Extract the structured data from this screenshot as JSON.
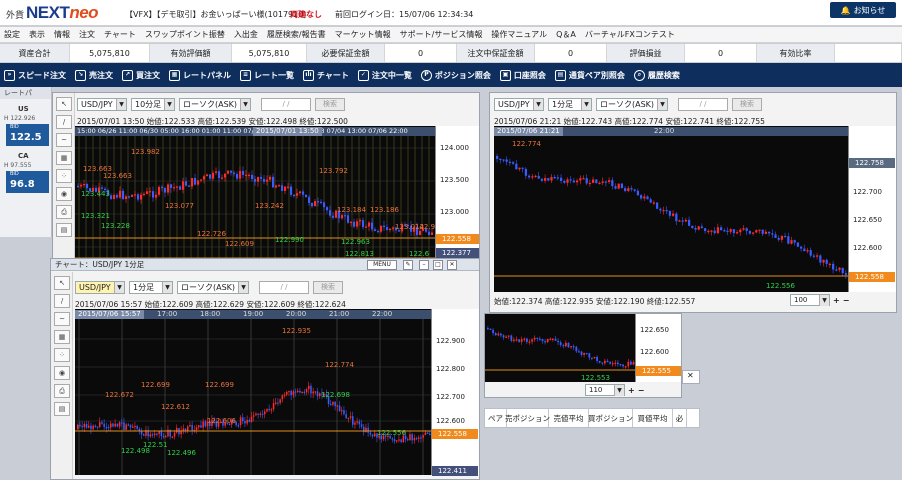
{
  "header": {
    "logo_prefix": "外貨",
    "logo_main": "NEXT",
    "logo_neo": "neo",
    "account": "【VFX】【デモ取引】お金いっぱーい様(1017910)",
    "dup_status": "両建なし",
    "last_login": "前回ログイン日：15/07/06 12:34:34",
    "news_button": "お知らせ"
  },
  "menu": [
    "設定",
    "表示",
    "情報",
    "注文",
    "チャート",
    "スワップポイント振替",
    "入出金",
    "履歴検索/報告書",
    "マーケット情報",
    "サポート/サービス情報",
    "操作マニュアル",
    "Q＆A",
    "バーチャルFXコンテスト"
  ],
  "summary": [
    {
      "label": "資産合計",
      "value": "5,075,810"
    },
    {
      "label": "有効評価額",
      "value": "5,075,810"
    },
    {
      "label": "必要保証金額",
      "value": "0"
    },
    {
      "label": "注文中保証金額",
      "value": "0"
    },
    {
      "label": "評価損益",
      "value": "0"
    },
    {
      "label": "有効比率",
      "value": ""
    }
  ],
  "toolbar": [
    "スピード注文",
    "売注文",
    "買注文",
    "レートパネル",
    "レート一覧",
    "チャート",
    "注文中一覧",
    "ポジション照会",
    "口座照会",
    "通貨ペア別照会",
    "履歴検索"
  ],
  "rate_panel": {
    "head": "レートパ",
    "pairs": [
      {
        "pair": "US",
        "high": "H 122.926",
        "bid": "122.5",
        "bid_label": "BID"
      },
      {
        "pair": "CA",
        "high": "H 97.555",
        "bid": "96.8",
        "bid_label": "BID"
      }
    ]
  },
  "chart1": {
    "pair": "USD/JPY",
    "period": "10分足",
    "type": "ローソク(ASK)",
    "date": "/ /",
    "search": "検索",
    "ohlc": "2015/07/01 13:50 始値:122.533 高値:122.539 安値:122.498 終値:122.500",
    "time_highlight": "2015/07/01 13:50",
    "time_axis": [
      "15:00",
      "06/26",
      "11:00",
      "06/30",
      "05:00",
      "16:00",
      "01:00",
      "11:00",
      "07/02",
      "11:00",
      "20:00",
      "07/03",
      "07/04",
      "13:00",
      "07/06",
      "22:00"
    ],
    "y_labels": [
      "124.000",
      "123.500",
      "123.000"
    ],
    "tags": [
      "122.558",
      "122.377"
    ],
    "price_labels_orange": [
      "123.982",
      "123.663",
      "123.752",
      "123.077",
      "122.726",
      "123.792",
      "123.242",
      "123.184",
      "123.186",
      "123.014",
      "122.609",
      "122.916"
    ],
    "price_labels_green": [
      "123.443",
      "123.228",
      "123.321",
      "122.990",
      "122.963",
      "122.813",
      "122.6"
    ]
  },
  "chart2": {
    "pair": "USD/JPY",
    "period": "1分足",
    "type": "ローソク(ASK)",
    "date": "/ /",
    "search": "検索",
    "ohlc": "2015/07/06 21:21 始値:122.743 高値:122.774 安値:122.741 終値:122.755",
    "time_highlight": "2015/07/06 21:21",
    "time_axis": [
      "22:00"
    ],
    "y_labels": [
      "122.700",
      "122.650",
      "122.600"
    ],
    "tags": [
      "122.758",
      "122.558"
    ],
    "price_labels_orange": [
      "122.774"
    ],
    "price_labels_green": [
      "122.556"
    ],
    "footer": "始値:122.374 高値:122.935 安値:122.190 終値:122.557",
    "page": "100"
  },
  "chart3": {
    "title": "チャート：USD/JPY 1分足",
    "menu": "MENU",
    "pair": "USD/JPY",
    "period": "1分足",
    "type": "ローソク(ASK)",
    "date": "/ /",
    "search": "検索",
    "ohlc": "2015/07/06 15:57 始値:122.609 高値:122.629 安値:122.609 終値:122.624",
    "time_highlight": "2015/07/06 15:57",
    "time_axis": [
      "17:00",
      "18:00",
      "19:00",
      "20:00",
      "21:00",
      "22:00"
    ],
    "y_labels": [
      "122.900",
      "122.800",
      "122.700",
      "122.600"
    ],
    "tags": [
      "122.558",
      "122.411"
    ],
    "price_labels_orange": [
      "122.935",
      "122.774",
      "122.699",
      "122.699",
      "122.672",
      "122.612",
      "122.606"
    ],
    "price_labels_green": [
      "122.698",
      "122.498",
      "122.51",
      "122.496",
      "122.556"
    ]
  },
  "chart4": {
    "y_labels": [
      "122.650",
      "122.600"
    ],
    "tags": [
      "122.555"
    ],
    "price_labels_green": [
      "122.553"
    ],
    "page": "110"
  },
  "positions": [
    "ペア",
    "売ポジション",
    "売値平均",
    "買ポジション",
    "買値平均",
    "必"
  ]
}
